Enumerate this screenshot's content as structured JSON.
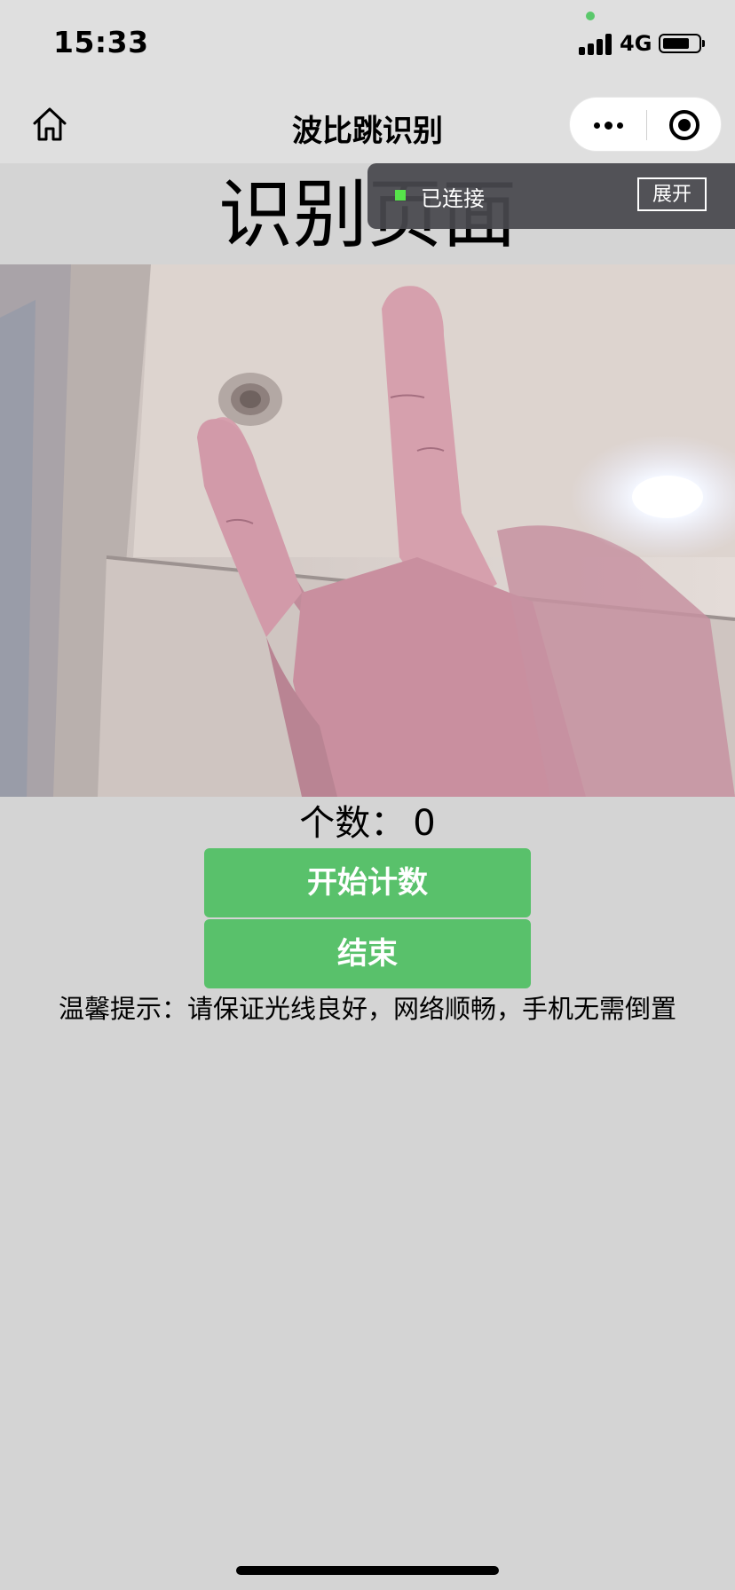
{
  "status_bar": {
    "time": "15:33",
    "network": "4G",
    "battery_level": 0.75,
    "signal_bars": 4
  },
  "nav": {
    "title": "波比跳识别",
    "home_icon": "home-icon",
    "more_icon": "more-dots-icon",
    "close_icon": "target-circle-icon"
  },
  "page": {
    "title": "识别页面"
  },
  "connection": {
    "status": "已连接",
    "expand_label": "展开",
    "indicator_color": "#56e34a"
  },
  "counter": {
    "label": "个数：",
    "value": "0"
  },
  "buttons": {
    "start_label": "开始计数",
    "stop_label": "结束",
    "color": "#59c16b"
  },
  "tip": {
    "text": "温馨提示：请保证光线良好，网络顺畅，手机无需倒置"
  }
}
